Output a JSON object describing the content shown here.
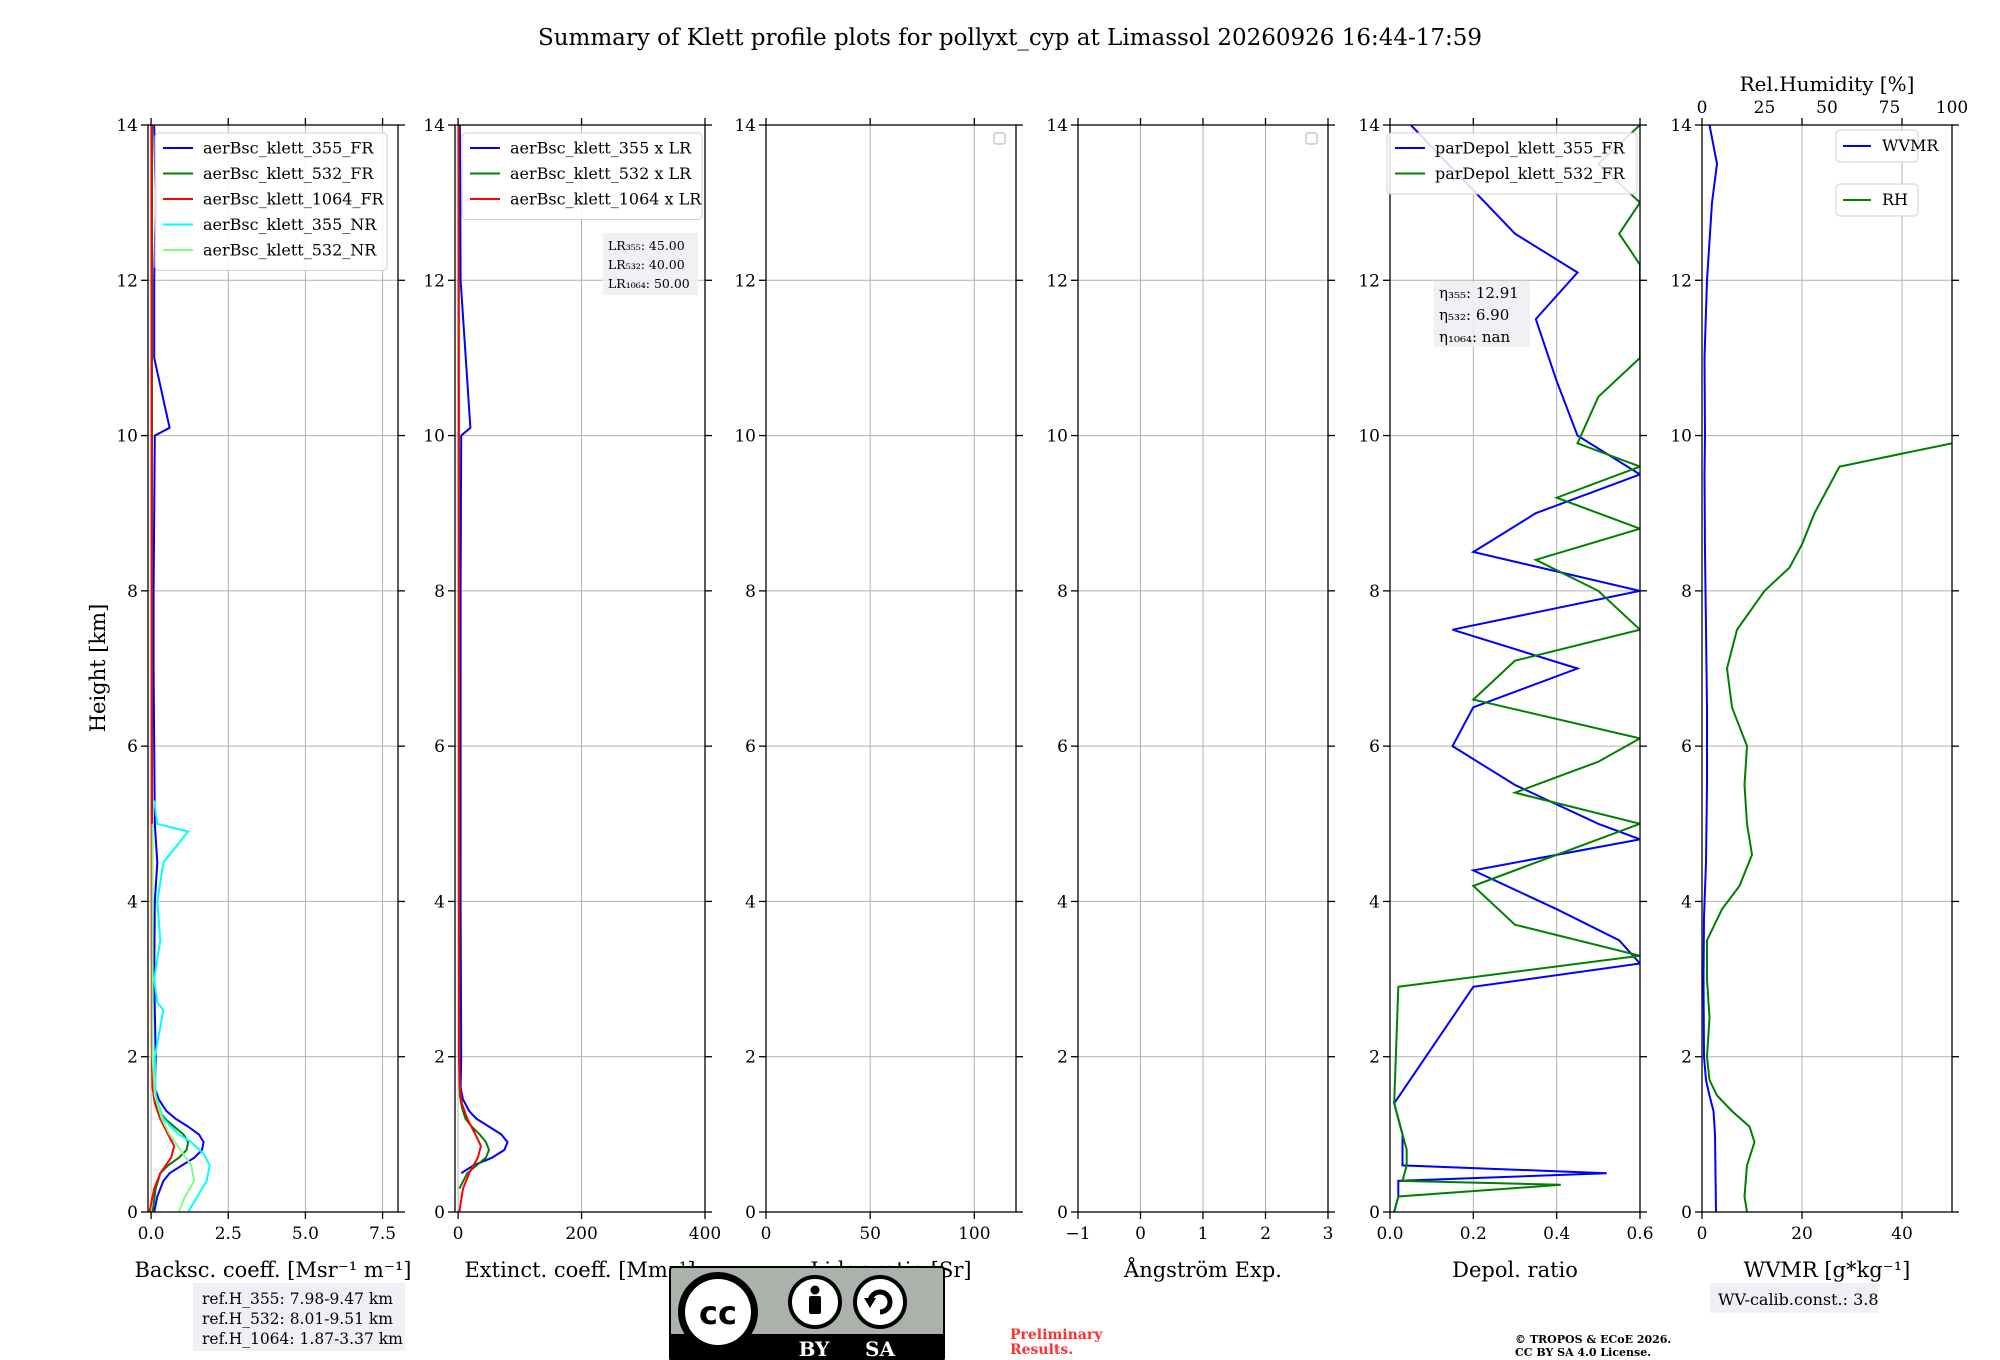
{
  "figure": {
    "title": "Summary of Klett profile plots for pollyxt_cyp at Limassol 20260926 16:44-17:59",
    "ylabel": "Height [km]",
    "refbox_lines": [
      "ref.H_355: 7.98-9.47 km",
      "ref.H_532: 8.01-9.51 km",
      "ref.H_1064: 1.87-3.37 km"
    ],
    "cc_text": [
      "BY",
      "SA"
    ],
    "preliminary": [
      "Preliminary",
      "Results."
    ],
    "copyright": [
      "© TROPOS & ECoE 2026.",
      "CC BY SA 4.0 License."
    ],
    "wv_calib": "WV-calib.const.: 3.8"
  },
  "chart_data": [
    {
      "type": "line",
      "title": "",
      "xlabel": "Backsc. coeff. [Msr⁻¹ m⁻¹]",
      "ylabel": "Height [km]",
      "xlim": [
        -0.1,
        8.0
      ],
      "ylim": [
        0,
        14
      ],
      "xticks": [
        "0.0",
        "2.5",
        "5.0",
        "7.5"
      ],
      "yticks": [
        "0",
        "2",
        "4",
        "6",
        "8",
        "10",
        "12",
        "14"
      ],
      "grid": true,
      "legend_position": "top",
      "series": [
        {
          "name": "aerBsc_klett_355_FR",
          "color": "#0000ff",
          "y": [
            0,
            0.2,
            0.4,
            0.5,
            0.6,
            0.7,
            0.8,
            0.9,
            1.0,
            1.1,
            1.2,
            1.3,
            1.45,
            1.6,
            2.0,
            3.0,
            4.0,
            4.5,
            5.0,
            6.0,
            7.0,
            8.0,
            9.0,
            10.0,
            10.1,
            11.0,
            12.0,
            13.0,
            14.0
          ],
          "x": [
            0.1,
            0.2,
            0.4,
            0.6,
            1.0,
            1.4,
            1.65,
            1.7,
            1.55,
            1.2,
            0.8,
            0.5,
            0.25,
            0.12,
            0.15,
            0.1,
            0.12,
            0.2,
            0.12,
            0.1,
            0.08,
            0.08,
            0.1,
            0.12,
            0.6,
            0.1,
            0.1,
            0.15,
            0.1
          ]
        },
        {
          "name": "aerBsc_klett_532_FR",
          "color": "#008000",
          "y": [
            0,
            0.3,
            0.5,
            0.6,
            0.7,
            0.8,
            0.9,
            1.0,
            1.1,
            1.2,
            1.35,
            1.5,
            2.0,
            4.0,
            8.0,
            14.0
          ],
          "x": [
            0.05,
            0.15,
            0.3,
            0.55,
            0.9,
            1.15,
            1.2,
            1.05,
            0.75,
            0.45,
            0.2,
            0.08,
            0.04,
            0.03,
            0.03,
            0.03
          ]
        },
        {
          "name": "aerBsc_klett_1064_FR",
          "color": "#ff0000",
          "y": [
            0,
            0.3,
            0.5,
            0.7,
            0.85,
            1.0,
            1.2,
            1.4,
            1.6,
            2.0,
            4.0,
            8.0,
            14.0
          ],
          "x": [
            -0.05,
            0.1,
            0.3,
            0.65,
            0.75,
            0.55,
            0.3,
            0.12,
            0.05,
            0.03,
            0.02,
            0.02,
            0.01
          ]
        },
        {
          "name": "aerBsc_klett_355_NR",
          "color": "#00ffff",
          "y": [
            0,
            0.2,
            0.4,
            0.6,
            0.75,
            0.9,
            1.0,
            1.2,
            1.5,
            2.0,
            2.6,
            2.7,
            3.0,
            3.5,
            4.0,
            4.5,
            4.9,
            5.0,
            5.3
          ],
          "x": [
            1.2,
            1.5,
            1.8,
            1.9,
            1.7,
            1.3,
            0.9,
            0.4,
            0.15,
            0.12,
            0.4,
            0.2,
            0.1,
            0.3,
            0.2,
            0.4,
            1.2,
            0.2,
            0.1
          ]
        },
        {
          "name": "aerBsc_klett_532_NR",
          "color": "#7fff7f",
          "y": [
            0,
            0.2,
            0.4,
            0.6,
            0.8,
            1.0,
            1.2,
            1.5,
            2.0,
            3.0,
            4.0,
            5.0
          ],
          "x": [
            0.9,
            1.1,
            1.4,
            1.3,
            0.95,
            0.6,
            0.35,
            0.12,
            0.05,
            0.05,
            0.05,
            0.05
          ]
        }
      ]
    },
    {
      "type": "line",
      "title": "",
      "xlabel": "Extinct. coeff. [Mm⁻¹]",
      "xlim": [
        -5,
        400
      ],
      "ylim": [
        0,
        14
      ],
      "xticks": [
        "0",
        "200",
        "400"
      ],
      "yticks": [
        "0",
        "2",
        "4",
        "6",
        "8",
        "10",
        "12",
        "14"
      ],
      "grid": true,
      "legend_position": "top",
      "annotation": [
        "LR₃₅₅: 45.00",
        "LR₅₃₂: 40.00",
        "LR₁₀₆₄: 50.00"
      ],
      "series": [
        {
          "name": "aerBsc_klett_355 x LR",
          "color": "#0000ff",
          "y": [
            0.5,
            0.6,
            0.7,
            0.8,
            0.9,
            1.0,
            1.1,
            1.2,
            1.3,
            1.45,
            1.6,
            2.0,
            4.0,
            8.0,
            10.0,
            10.1,
            12.0,
            14.0
          ],
          "x": [
            5,
            25,
            55,
            75,
            80,
            70,
            50,
            30,
            18,
            8,
            4,
            5,
            4,
            4,
            5,
            20,
            4,
            3
          ]
        },
        {
          "name": "aerBsc_klett_532 x LR",
          "color": "#008000",
          "y": [
            0.3,
            0.5,
            0.6,
            0.7,
            0.8,
            0.9,
            1.0,
            1.1,
            1.2,
            1.35,
            1.5,
            2.0,
            14.0
          ],
          "x": [
            2,
            15,
            30,
            45,
            50,
            45,
            35,
            22,
            12,
            6,
            3,
            2,
            1
          ]
        },
        {
          "name": "aerBsc_klett_1064 x LR",
          "color": "#ff0000",
          "y": [
            0,
            0.3,
            0.5,
            0.7,
            0.85,
            1.0,
            1.2,
            1.4,
            1.6,
            2.0,
            14.0
          ],
          "x": [
            2,
            8,
            18,
            32,
            37,
            28,
            15,
            6,
            3,
            1.5,
            0.5
          ]
        }
      ]
    },
    {
      "type": "line",
      "title": "",
      "xlabel": "Lidar ratio [Sr]",
      "xlim": [
        0,
        120
      ],
      "ylim": [
        0,
        14
      ],
      "xticks": [
        "0",
        "50",
        "100"
      ],
      "yticks": [
        "0",
        "2",
        "4",
        "6",
        "8",
        "10",
        "12",
        "14"
      ],
      "grid": true,
      "series": []
    },
    {
      "type": "line",
      "title": "",
      "xlabel": "Ångström Exp.",
      "xlim": [
        -1,
        3
      ],
      "ylim": [
        0,
        14
      ],
      "xticks": [
        "−1",
        "0",
        "1",
        "2",
        "3"
      ],
      "yticks": [
        "0",
        "2",
        "4",
        "6",
        "8",
        "10",
        "12",
        "14"
      ],
      "grid": true,
      "series": []
    },
    {
      "type": "line",
      "title": "",
      "xlabel": "Depol. ratio",
      "xlim": [
        0,
        0.6
      ],
      "ylim": [
        0,
        14
      ],
      "xticks": [
        "0.0",
        "0.2",
        "0.4",
        "0.6"
      ],
      "yticks": [
        "0",
        "2",
        "4",
        "6",
        "8",
        "10",
        "12",
        "14"
      ],
      "grid": true,
      "legend_position": "top",
      "annotation": [
        "η₃₅₅: 12.91",
        "η₅₃₂: 6.90",
        "η₁₀₆₄: nan"
      ],
      "series": [
        {
          "name": "parDepol_klett_355_FR",
          "color": "#0000ff",
          "y": [
            0,
            0.2,
            0.4,
            0.5,
            0.6,
            0.8,
            1.0,
            1.2,
            1.4,
            2.9,
            3.2,
            3.5,
            3.9,
            4.4,
            4.8,
            5.0,
            5.5,
            6.0,
            6.5,
            7.0,
            7.5,
            8.0,
            8.5,
            9.0,
            9.5,
            10.0,
            10.7,
            11.5,
            12.1,
            12.6,
            14.0
          ],
          "x": [
            0.01,
            0.02,
            0.02,
            0.52,
            0.03,
            0.03,
            0.03,
            0.02,
            0.01,
            0.2,
            0.6,
            0.55,
            0.4,
            0.2,
            0.6,
            0.5,
            0.3,
            0.15,
            0.2,
            0.45,
            0.15,
            0.6,
            0.2,
            0.35,
            0.6,
            0.45,
            0.4,
            0.35,
            0.45,
            0.3,
            0.05
          ]
        },
        {
          "name": "parDepol_klett_532_FR",
          "color": "#008000",
          "y": [
            0,
            0.2,
            0.35,
            0.4,
            0.6,
            0.8,
            1.0,
            1.2,
            1.4,
            2.9,
            3.3,
            3.7,
            4.2,
            4.6,
            5.0,
            5.4,
            5.8,
            6.1,
            6.6,
            7.1,
            7.5,
            8.0,
            8.4,
            8.8,
            9.2,
            9.6,
            9.9,
            10.5,
            11.0,
            11.6,
            12.2,
            12.6,
            13.0,
            13.5,
            14.0
          ],
          "x": [
            0.01,
            0.02,
            0.41,
            0.03,
            0.04,
            0.04,
            0.03,
            0.02,
            0.01,
            0.02,
            0.6,
            0.3,
            0.2,
            0.4,
            0.6,
            0.3,
            0.5,
            0.6,
            0.2,
            0.3,
            0.6,
            0.5,
            0.35,
            0.6,
            0.4,
            0.6,
            0.45,
            0.5,
            0.6,
            0.6,
            0.6,
            0.55,
            0.6,
            0.5,
            0.6
          ]
        }
      ]
    },
    {
      "type": "line",
      "title": "",
      "xlabel": "WVMR [g*kg⁻¹]",
      "top_xlabel": "Rel.Humidity [%]",
      "xlim": [
        0,
        50
      ],
      "top_xlim": [
        0,
        100
      ],
      "ylim": [
        0,
        14
      ],
      "xticks": [
        "0",
        "20",
        "40"
      ],
      "top_xticks": [
        "0",
        "25",
        "50",
        "75",
        "100"
      ],
      "yticks": [
        "0",
        "2",
        "4",
        "6",
        "8",
        "10",
        "12",
        "14"
      ],
      "grid": true,
      "legend_position": "top-right",
      "series": [
        {
          "name": "WVMR",
          "color": "#0000ff",
          "axis": "bottom",
          "y": [
            0,
            0.5,
            1.0,
            1.3,
            1.5,
            1.7,
            2.0,
            3.0,
            3.8,
            4.5,
            5.5,
            6.5,
            7.5,
            8.5,
            9.5,
            10.0,
            11.0,
            12.0,
            12.5,
            13.0,
            13.5,
            14.0
          ],
          "x": [
            2.8,
            2.7,
            2.6,
            2.3,
            1.5,
            0.8,
            0.4,
            0.3,
            0.4,
            0.8,
            1.0,
            1.0,
            0.8,
            0.6,
            0.5,
            0.6,
            0.5,
            1.0,
            1.5,
            2.0,
            3.0,
            1.5
          ]
        },
        {
          "name": "RH",
          "color": "#008000",
          "axis": "top",
          "y": [
            0,
            0.2,
            0.6,
            0.9,
            1.1,
            1.3,
            1.5,
            1.7,
            2.0,
            2.5,
            3.0,
            3.5,
            3.9,
            4.2,
            4.6,
            5.0,
            5.5,
            6.0,
            6.5,
            7.0,
            7.5,
            8.0,
            8.3,
            8.6,
            9.0,
            9.3,
            9.6,
            9.9
          ],
          "x": [
            18,
            17,
            18,
            21,
            19,
            12,
            6,
            3,
            2,
            3,
            2,
            2,
            8,
            15,
            20,
            18,
            17,
            18,
            12,
            10,
            14,
            25,
            35,
            40,
            45,
            50,
            55,
            100
          ]
        }
      ]
    }
  ]
}
